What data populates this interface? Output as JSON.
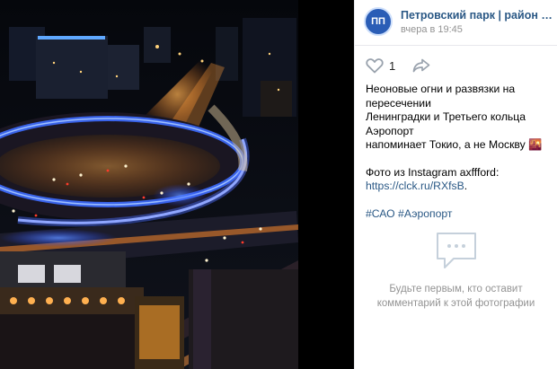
{
  "group": {
    "avatar_text": "ПП",
    "name": "Петровский парк | район Аэропорт",
    "date": "вчера в 19:45"
  },
  "actions": {
    "like_count": "1",
    "like_icon": "heart-outline",
    "share_icon": "share-arrow"
  },
  "post": {
    "line1": "Неоновые огни и развязки на пересечении",
    "line2": "Ленинградки и Третьего кольца Аэропорт",
    "line3": "напоминает Токио, а не Москву",
    "line3_emoji": "🌇",
    "photo_credit": "Фото из Instagram axffford:",
    "link": "https://clck.ru/RXfsB",
    "link_suffix": ".",
    "hashtag1": "#САО",
    "hashtag2": "#Аэропорт"
  },
  "comments": {
    "empty_line1": "Будьте первым, кто оставит",
    "empty_line2": "комментарий к этой фотографии",
    "icon": "speech-bubble-icon"
  },
  "colors": {
    "link": "#2a5885",
    "muted": "#939393",
    "avatar_bg": "#2a5db6",
    "neon_blue": "#3d6cff",
    "road_orange": "#e8781e"
  }
}
